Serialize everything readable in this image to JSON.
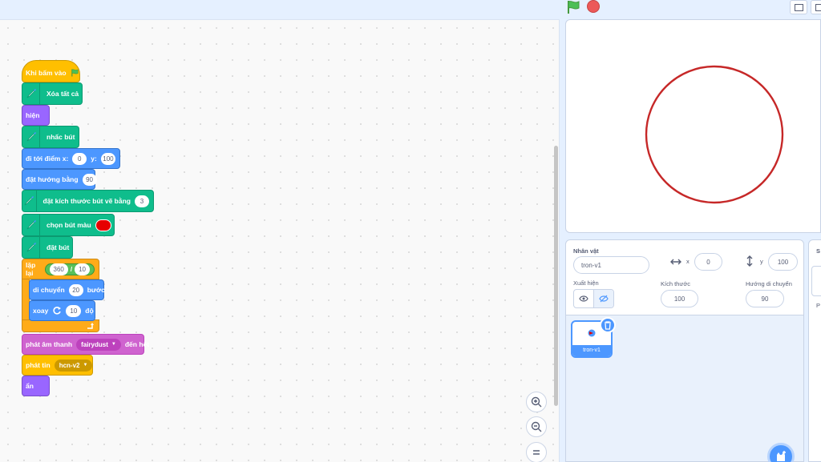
{
  "icons": {
    "flag": "green-flag-icon",
    "stop": "stop-icon",
    "pen": "pen-icon",
    "rotate": "rotate-right-icon",
    "loop_arrow": "loop-arrow-icon",
    "zoom_in": "zoom-in-icon",
    "zoom_out": "zoom-out-icon",
    "zoom_reset": "zoom-reset-icon",
    "eye": "eye-icon",
    "eye_off": "eye-off-icon",
    "trash": "trash-icon",
    "cat_add": "add-sprite-icon",
    "arrows_lr": "arrows-horizontal-icon",
    "arrows_ud": "arrows-vertical-icon"
  },
  "colors": {
    "pen_color": "#e60000",
    "circle_color": "#c62828"
  },
  "script": {
    "when_flag": "Khi bấm vào",
    "clear": "Xóa tất cả",
    "show": "hiện",
    "pen_up": "nhấc bút",
    "goto_label": "đi tới điểm x:",
    "goto_x": "0",
    "goto_y_label": "y:",
    "goto_y": "100",
    "point_label": "đặt hướng bằng",
    "point_value": "90",
    "pen_size_label": "đặt kích thước bút vẽ bằng",
    "pen_size_value": "3",
    "pen_color_label": "chọn bút màu",
    "pen_down": "đặt bút",
    "repeat_label": "lặp lại",
    "repeat_a": "360",
    "repeat_op": "/",
    "repeat_b": "10",
    "move_label": "di chuyển",
    "move_value": "20",
    "move_unit": "bước",
    "turn_label": "xoay",
    "turn_value": "10",
    "turn_unit": "độ",
    "sound_label": "phát âm thanh",
    "sound_name": "fairydust",
    "sound_until": "đến hết",
    "broadcast_label": "phát tin",
    "broadcast_name": "hcn-v2",
    "hide": "ẩn"
  },
  "sprite_info": {
    "sprite_label": "Nhân vật",
    "sprite_name": "tron-v1",
    "x_label": "x",
    "x_value": "0",
    "y_label": "y",
    "y_value": "100",
    "show_label": "Xuất hiện",
    "size_label": "Kích thước",
    "size_value": "100",
    "direction_label": "Hướng di chuyển",
    "direction_value": "90",
    "backdrop_letter": "S",
    "backdrop_letter2": "P"
  },
  "sprites": [
    {
      "name": "tron-v1"
    }
  ]
}
